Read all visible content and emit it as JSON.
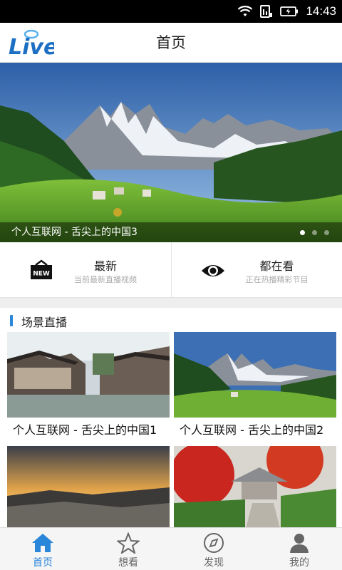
{
  "status_bar": {
    "time": "14:43"
  },
  "header": {
    "title": "首页",
    "logo_text": "Live"
  },
  "banner": {
    "caption": "个人互联网 - 舌尖上的中国3",
    "page_count": 3,
    "active_index": 0
  },
  "features": [
    {
      "title": "最新",
      "subtitle": "当前最新直播视频",
      "icon": "new-badge-icon",
      "badge": "NEW"
    },
    {
      "title": "都在看",
      "subtitle": "正在热播精彩节目",
      "icon": "eye-icon"
    }
  ],
  "section": {
    "title": "场景直播"
  },
  "cards": [
    {
      "caption": "个人互联网 - 舌尖上的中国1"
    },
    {
      "caption": "个人互联网 - 舌尖上的中国2"
    },
    {
      "caption": ""
    },
    {
      "caption": ""
    }
  ],
  "tabs": [
    {
      "label": "首页",
      "icon": "home-icon",
      "active": true
    },
    {
      "label": "想看",
      "icon": "star-icon",
      "active": false
    },
    {
      "label": "发现",
      "icon": "compass-icon",
      "active": false
    },
    {
      "label": "我的",
      "icon": "person-icon",
      "active": false
    }
  ],
  "colors": {
    "accent": "#2a86d8",
    "logo_blue": "#1d6fc4"
  }
}
